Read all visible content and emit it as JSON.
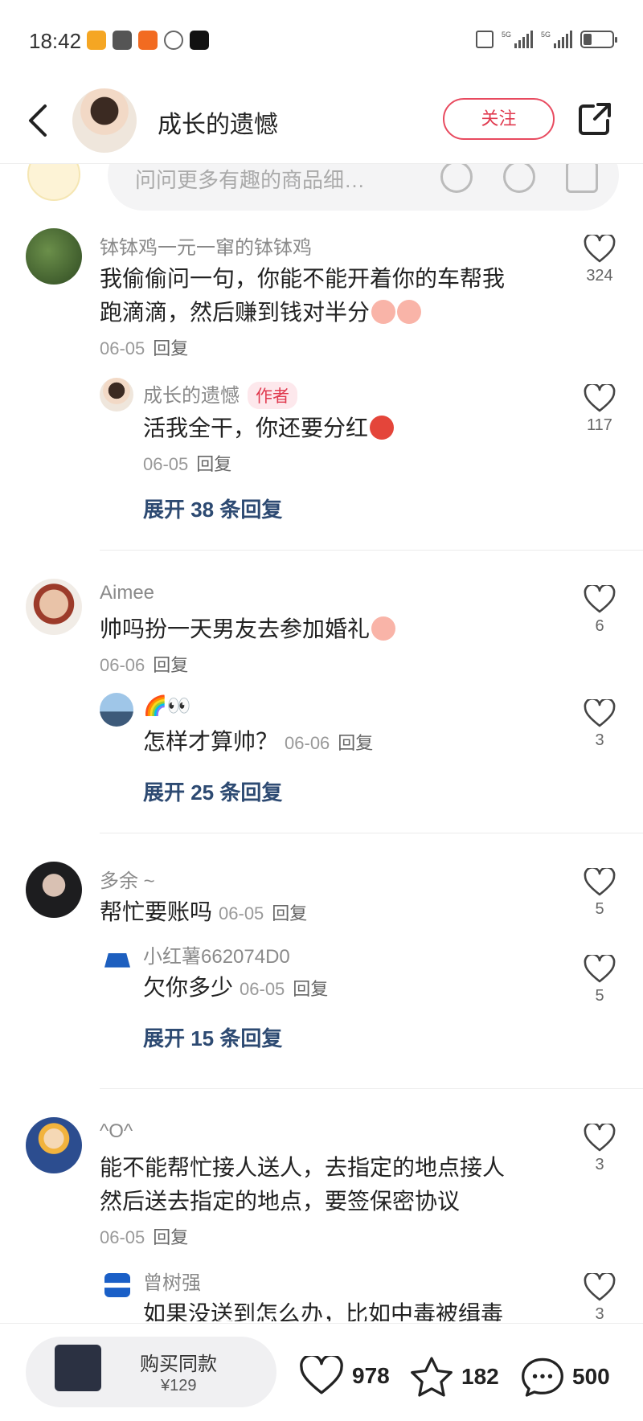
{
  "status_bar": {
    "time": "18:42",
    "network1": "5G",
    "network2": "5G"
  },
  "header": {
    "title": "成长的遗憾",
    "follow_label": "关注"
  },
  "input": {
    "placeholder": "问问更多有趣的商品细…"
  },
  "comments": [
    {
      "user": "钵钵鸡一元一窜的钵钵鸡",
      "text_line1": "我偷偷问一句，你能不能开着你的车帮我",
      "text_line2": "跑滴滴，然后赚到钱对半分",
      "date": "06-05",
      "reply": "回复",
      "likes": "324",
      "sub": {
        "user": "成长的遗憾",
        "tag": "作者",
        "text": "活我全干，你还要分红",
        "date": "06-05",
        "reply": "回复",
        "likes": "117"
      },
      "expand": "展开 38 条回复"
    },
    {
      "user": "Aimee",
      "text_line1": "帅吗扮一天男友去参加婚礼",
      "date": "06-06",
      "reply": "回复",
      "likes": "6",
      "sub": {
        "user": "🌈👀",
        "text": "怎样才算帅？",
        "date": "06-06",
        "reply": "回复",
        "likes": "3"
      },
      "expand": "展开 25 条回复"
    },
    {
      "user": "多余 ~",
      "text_line1": "帮忙要账吗",
      "date": "06-05",
      "reply": "回复",
      "likes": "5",
      "sub": {
        "user": "小红薯662074D0",
        "text": "欠你多少",
        "date": "06-05",
        "reply": "回复",
        "likes": "5"
      },
      "expand": "展开 15 条回复"
    },
    {
      "user": "^O^",
      "text_line1": "能不能帮忙接人送人，去指定的地点接人",
      "text_line2": "然后送去指定的地点，要签保密协议",
      "date": "06-05",
      "reply": "回复",
      "likes": "3",
      "sub": {
        "user": "曾树强",
        "text": "如果没送到怎么办，比如中毒被缉毒",
        "likes": "3"
      }
    }
  ],
  "bottom": {
    "buy_label": "购买同款",
    "price": "¥129",
    "likes": "978",
    "favorites": "182",
    "comments": "500"
  },
  "colors": {
    "accent": "#e03a4f",
    "expand": "#2d4a72"
  }
}
